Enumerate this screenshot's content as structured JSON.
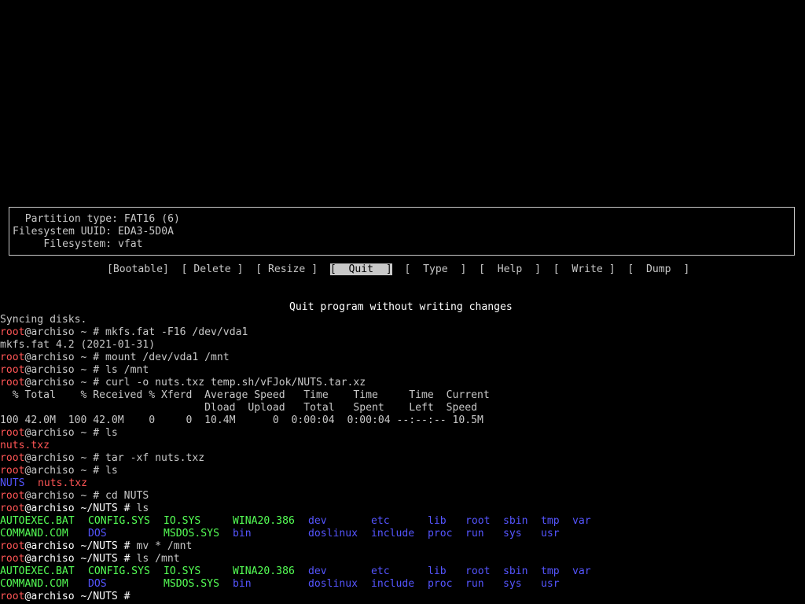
{
  "colors": {
    "background": "#000000",
    "text": "#c8c8c8",
    "user": "#ff5555",
    "directory": "#5555ff",
    "executable": "#55ff55",
    "selected_bg": "#c8c8c8"
  },
  "partition_info": {
    "type_line": "  Partition type: FAT16 (6)",
    "uuid_line": "Filesystem UUID: EDA3-5D0A",
    "fs_line": "     Filesystem: vfat"
  },
  "menu": {
    "bootable": "[Bootable]",
    "delete": "[ Delete ]",
    "resize": "[ Resize ]",
    "quit": "[  Quit  ]",
    "type": "[  Type  ]",
    "help": "[  Help  ]",
    "write": "[  Write ]",
    "dump": "[  Dump  ]"
  },
  "help_text": "Quit program without writing changes",
  "prompt": {
    "user": "root",
    "host_home": "@archiso ~ # ",
    "host_nuts": "@archiso ~/NUTS # "
  },
  "terminal": {
    "syncing": "Syncing disks.",
    "cmd_mkfs": "mkfs.fat -F16 /dev/vda1",
    "out_mkfs": "mkfs.fat 4.2 (2021-01-31)",
    "cmd_mount": "mount /dev/vda1 /mnt",
    "cmd_ls_mnt": "ls /mnt",
    "cmd_curl": "curl -o nuts.txz temp.sh/vFJok/NUTS.tar.xz",
    "curl_header1": "  % Total    % Received % Xferd  Average Speed   Time    Time     Time  Current",
    "curl_header2": "                                 Dload  Upload   Total   Spent    Left  Speed",
    "curl_progress": "100 42.0M  100 42.0M    0     0  10.4M      0  0:00:04  0:00:04 --:--:-- 10.5M",
    "cmd_ls": "ls",
    "file_nuts_txz": "nuts.txz",
    "cmd_tar": "tar -xf nuts.txz",
    "dir_nuts": "NUTS",
    "cmd_cd": "cd NUTS",
    "cmd_mv": "mv * /mnt",
    "cmd_ls_mnt2": "ls /mnt",
    "cursor_prompt_end": ""
  },
  "listing": {
    "autoexec": "AUTOEXEC.BAT",
    "config": "CONFIG.SYS",
    "io": "IO.SYS",
    "wina20": "WINA20.386",
    "dev": "dev",
    "etc": "etc",
    "lib": "lib",
    "root": "root",
    "sbin": "sbin",
    "tmp": "tmp",
    "var": "var",
    "command": "COMMAND.COM",
    "dos": "DOS",
    "msdos": "MSDOS.SYS",
    "bin": "bin",
    "doslinux": "doslinux",
    "include": "include",
    "proc": "proc",
    "run": "run",
    "sys": "sys",
    "usr": "usr"
  }
}
